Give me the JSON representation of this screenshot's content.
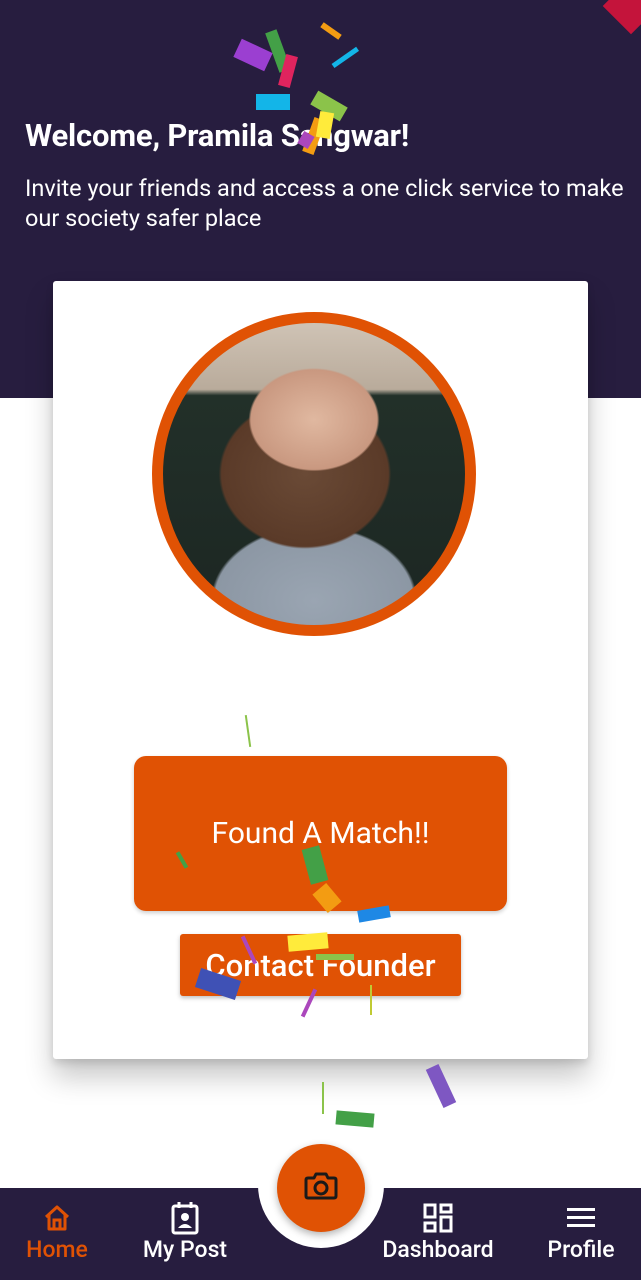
{
  "header": {
    "welcome": "Welcome, Pramila Sangwar!",
    "subtitle": "Invite your friends and access a one click service to make our society safer place"
  },
  "card": {
    "photo_icon": "profile-photo",
    "found_match_label": "Found A Match!!",
    "contact_founder_label": "Contact Founder"
  },
  "fab": {
    "icon": "camera-icon"
  },
  "nav": {
    "home": {
      "label": "Home",
      "icon": "home-icon"
    },
    "my_post": {
      "label": "My Post",
      "icon": "contact-card-icon"
    },
    "dashboard": {
      "label": "Dashboard",
      "icon": "dashboard-icon"
    },
    "profile": {
      "label": "Profile",
      "icon": "menu-icon"
    }
  },
  "colors": {
    "header_bg": "#271d3f",
    "accent": "#e05204",
    "nav_bg": "#271d3f"
  }
}
